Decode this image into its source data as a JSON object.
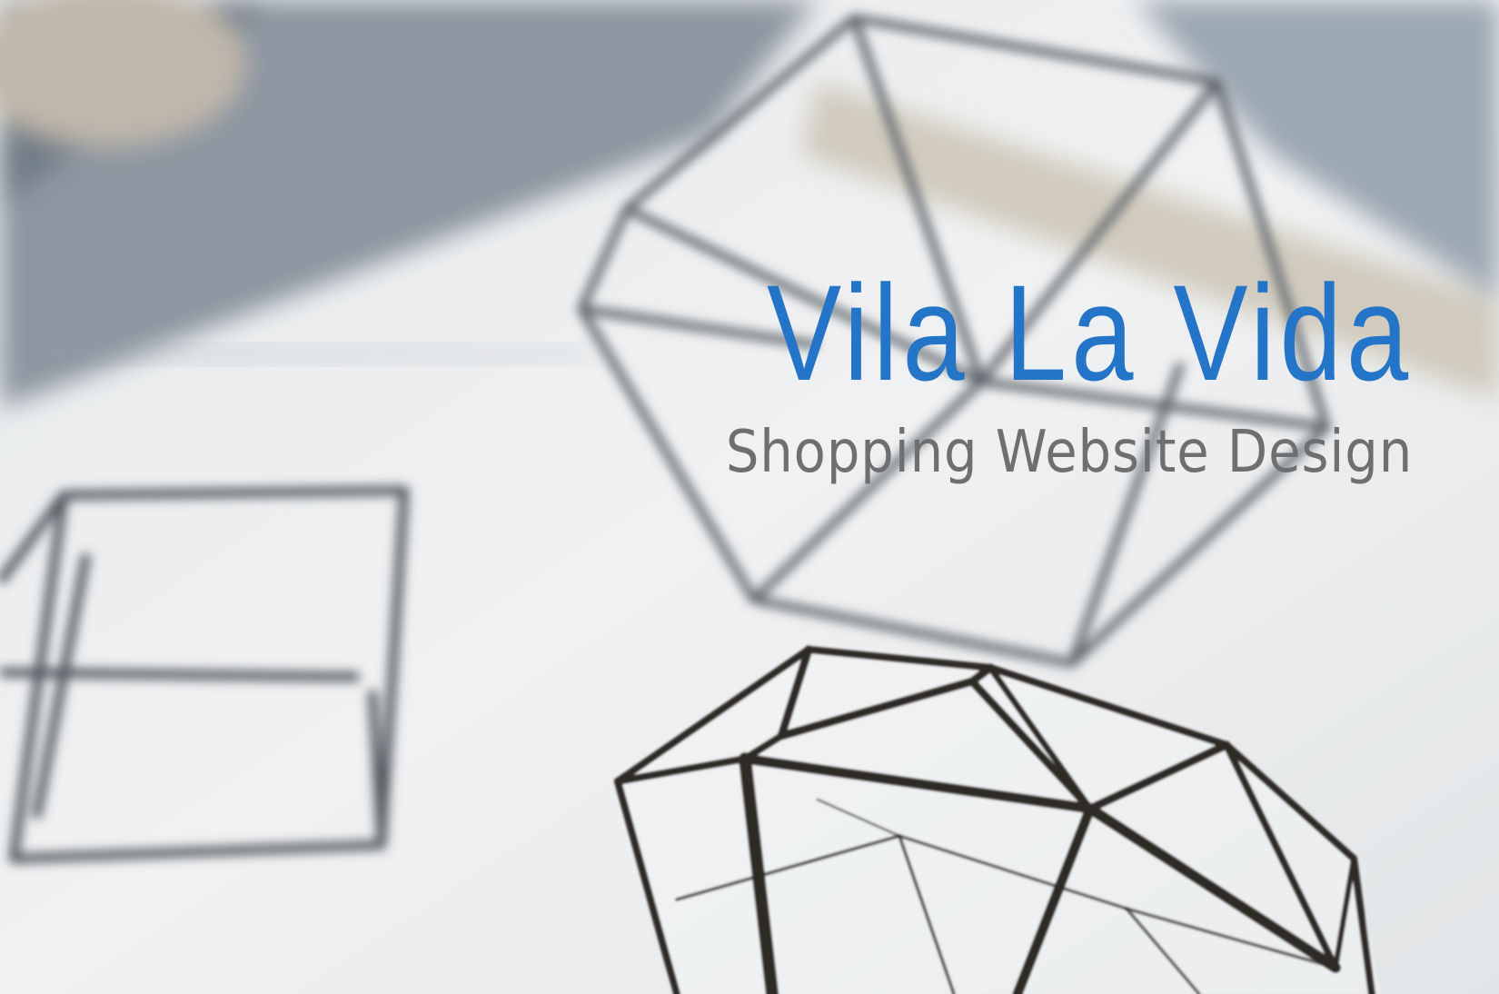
{
  "hero": {
    "title": "Vila La Vida",
    "subtitle": "Shopping Website Design",
    "title_color": "#2474c7",
    "subtitle_color": "#6d6f71",
    "background_image": "blurred photo of geometric glass terrariums with dark metal frames on a white table"
  }
}
